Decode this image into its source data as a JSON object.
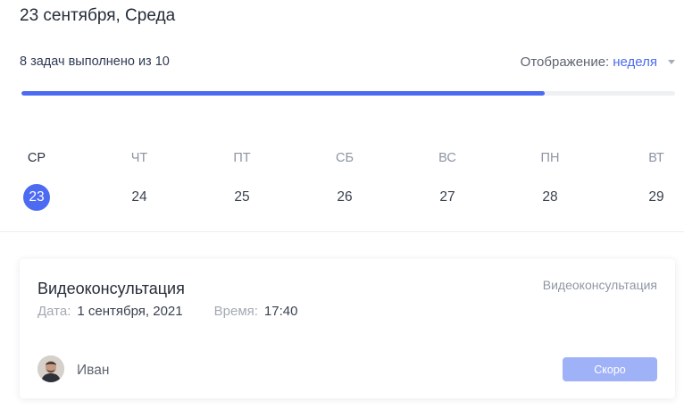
{
  "header": {
    "title": "23 сентября, Среда"
  },
  "progress": {
    "text": "8 задач выполнено из 10",
    "done": 8,
    "total": 10,
    "fraction": 0.8
  },
  "view": {
    "label": "Отображение:",
    "value": "неделя"
  },
  "days": [
    {
      "dow": "СР",
      "num": "23",
      "active": true
    },
    {
      "dow": "ЧТ",
      "num": "24",
      "active": false
    },
    {
      "dow": "ПТ",
      "num": "25",
      "active": false
    },
    {
      "dow": "СБ",
      "num": "26",
      "active": false
    },
    {
      "dow": "ВС",
      "num": "27",
      "active": false
    },
    {
      "dow": "ПН",
      "num": "28",
      "active": false
    },
    {
      "dow": "ВТ",
      "num": "29",
      "active": false
    }
  ],
  "card": {
    "title": "Видеоконсультация",
    "type": "Видеоконсультация",
    "date_label": "Дата:",
    "date_value": "1 сентября, 2021",
    "time_label": "Время:",
    "time_value": "17:40",
    "user_name": "Иван",
    "button_label": "Скоро"
  },
  "colors": {
    "accent": "#4d6bf2",
    "button_disabled": "#9fb2f7",
    "track": "#eef0f3"
  }
}
